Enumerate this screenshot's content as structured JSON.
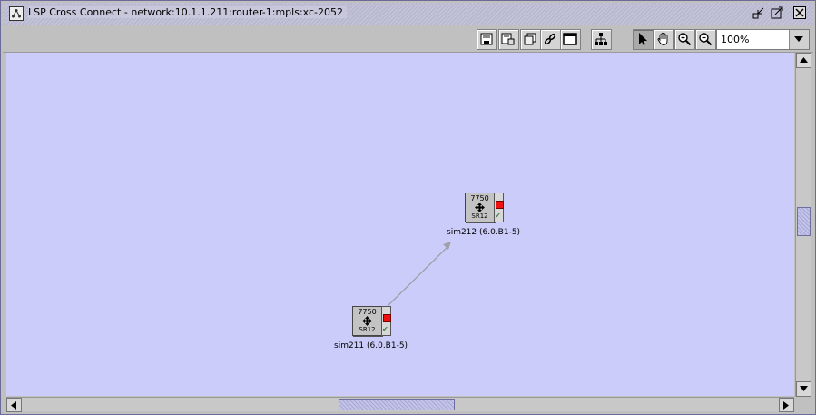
{
  "window": {
    "title": "LSP Cross Connect - network:10.1.1.211:router-1:mpls:xc-2052",
    "controls": [
      "minimize-icon",
      "maximize-icon",
      "close-icon"
    ]
  },
  "toolbar": {
    "tools": [
      "save-icon",
      "save-as-icon",
      "copy-icon",
      "link-icon",
      "fit-window-icon",
      "layout-icon",
      "select-arrow-icon",
      "pan-hand-icon",
      "zoom-in-icon",
      "zoom-out-icon"
    ],
    "zoom_value": "100%"
  },
  "nodes": [
    {
      "model": "7750",
      "type": "SR12",
      "label": "sim212 (6.0.B1-5)",
      "status_color": "#ee1111"
    },
    {
      "model": "7750",
      "type": "SR12",
      "label": "sim211 (6.0.B1-5)",
      "status_color": "#ee1111"
    }
  ],
  "link": {
    "from": "sim211 (6.0.B1-5)",
    "to": "sim212 (6.0.B1-5)"
  },
  "colors": {
    "canvas": "#ccccfb",
    "status_led": "#ee1111"
  }
}
